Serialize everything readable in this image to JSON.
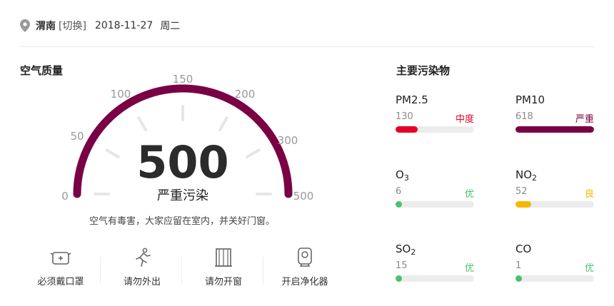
{
  "header": {
    "city": "渭南",
    "switch_label": "[切换]",
    "date": "2018-11-27",
    "weekday": "周二"
  },
  "air_quality": {
    "title": "空气质量",
    "aqi": "500",
    "level": "严重污染",
    "advice": "空气有毒害，大家应留在室内，并关好门窗。",
    "scale_labels": [
      "0",
      "50",
      "100",
      "150",
      "200",
      "300",
      "500"
    ],
    "gauge_fraction": 1.0,
    "gauge_color": "#7a0045",
    "actions": [
      {
        "label": "必须戴口罩",
        "icon": "mask-icon"
      },
      {
        "label": "请勿外出",
        "icon": "running-person-icon"
      },
      {
        "label": "请勿开窗",
        "icon": "window-icon"
      },
      {
        "label": "开启净化器",
        "icon": "air-purifier-icon"
      }
    ]
  },
  "pollutants": {
    "title": "主要污染物",
    "items": [
      {
        "name": "PM2.5",
        "value": "130",
        "level": "中度",
        "level_color": "#e60026",
        "bar_color": "#e60026",
        "fill_fraction": 0.28
      },
      {
        "name": "PM10",
        "value": "618",
        "level": "严重",
        "level_color": "#7a0045",
        "bar_color": "#7a0045",
        "fill_fraction": 1.0
      },
      {
        "name": "O",
        "sub": "3",
        "value": "6",
        "level": "优",
        "level_color": "#46c36b",
        "bar_color": "#46c36b",
        "fill_fraction": 0.05
      },
      {
        "name": "NO",
        "sub": "2",
        "value": "52",
        "level": "良",
        "level_color": "#f5b800",
        "bar_color": "#f5b800",
        "fill_fraction": 0.2
      },
      {
        "name": "SO",
        "sub": "2",
        "value": "15",
        "level": "优",
        "level_color": "#46c36b",
        "bar_color": "#46c36b",
        "fill_fraction": 0.05
      },
      {
        "name": "CO",
        "value": "1",
        "level": "优",
        "level_color": "#46c36b",
        "bar_color": "#46c36b",
        "fill_fraction": 0.05
      }
    ]
  }
}
